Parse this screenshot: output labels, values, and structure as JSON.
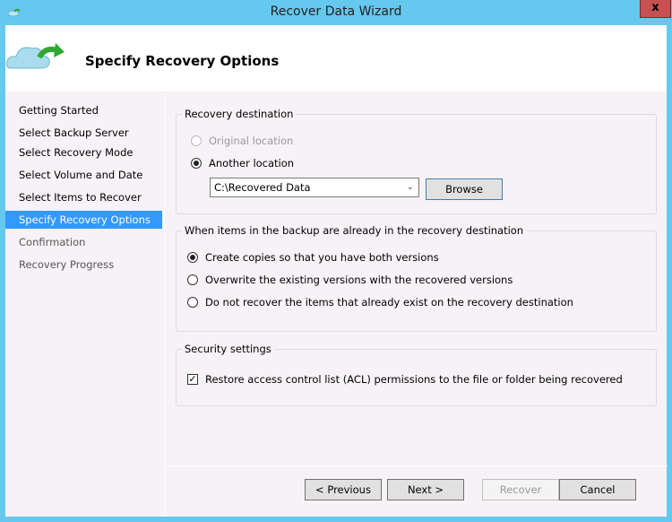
{
  "window": {
    "title": "Recover Data Wizard",
    "close_label": "x"
  },
  "header": {
    "title": "Specify Recovery Options"
  },
  "sidebar": {
    "items": [
      {
        "label": "Getting Started",
        "state": "done"
      },
      {
        "label": "Select Backup Server",
        "state": "done"
      },
      {
        "label": "Select Recovery Mode",
        "state": "done"
      },
      {
        "label": "Select Volume and Date",
        "state": "done"
      },
      {
        "label": "Select Items to Recover",
        "state": "done"
      },
      {
        "label": "Specify Recovery Options",
        "state": "active"
      },
      {
        "label": "Confirmation",
        "state": "pending"
      },
      {
        "label": "Recovery Progress",
        "state": "pending"
      }
    ]
  },
  "destination": {
    "legend": "Recovery destination",
    "original_label": "Original location",
    "another_label": "Another location",
    "path_value": "C:\\Recovered Data",
    "browse_label": "Browse"
  },
  "conflict": {
    "legend": "When items in the backup are already in the recovery destination",
    "options": [
      "Create copies so that you have both versions",
      "Overwrite the existing versions with the recovered versions",
      "Do not recover the items that already exist on the recovery destination"
    ]
  },
  "security": {
    "legend": "Security settings",
    "acl_label": "Restore access control list (ACL) permissions to the file or folder being recovered",
    "acl_checked": true
  },
  "footer": {
    "previous": "< Previous",
    "next": "Next >",
    "recover": "Recover",
    "cancel": "Cancel"
  }
}
